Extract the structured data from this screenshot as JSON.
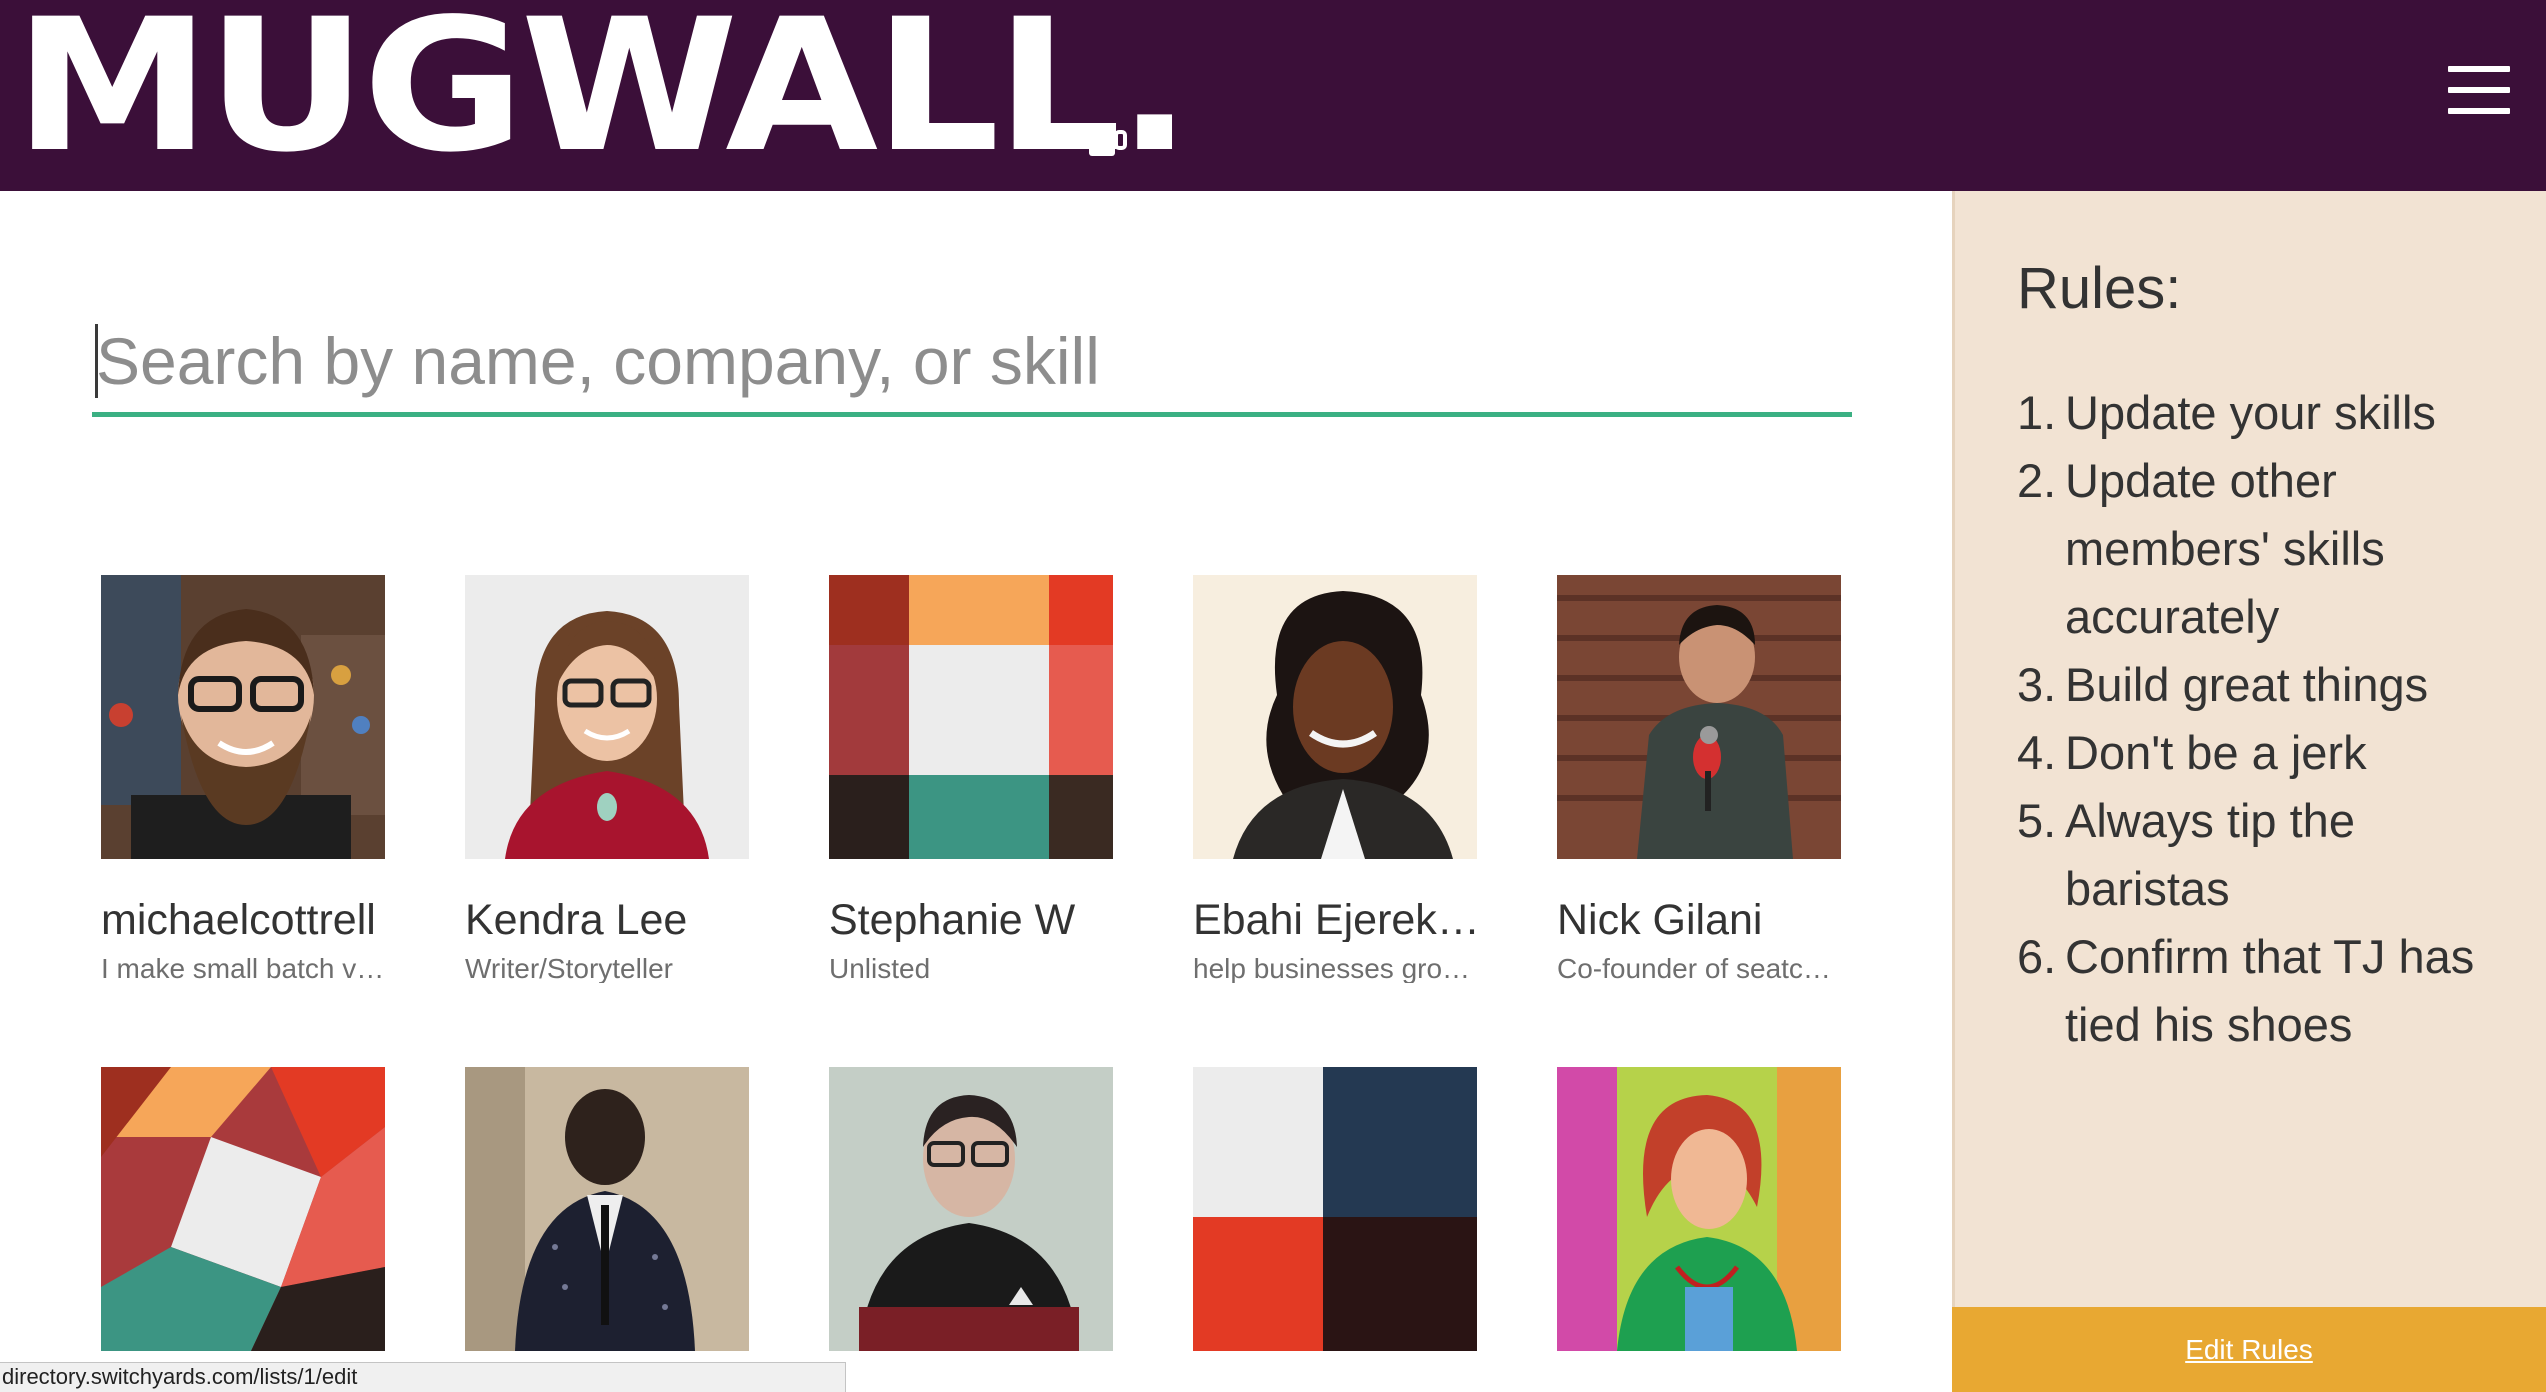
{
  "header": {
    "logo_text": "MUGWALL.",
    "menu_icon": "hamburger-menu-icon",
    "background": "#3b0f39"
  },
  "search": {
    "placeholder": "Search by name, company, or skill",
    "value": "",
    "accent": "#3bb083"
  },
  "members": [
    {
      "name": "michaelcottrell",
      "tagline": "I make small batch vid...",
      "avatar": "photo-bearded-man-glasses"
    },
    {
      "name": "Kendra Lee",
      "tagline": "Writer/Storyteller",
      "avatar": "photo-woman-glasses-red-top"
    },
    {
      "name": "Stephanie W",
      "tagline": "Unlisted",
      "avatar": "default-color-blocks"
    },
    {
      "name": "Ebahi Ejerekh...",
      "tagline": "help businesses grow ...",
      "avatar": "photo-woman-curly-hair"
    },
    {
      "name": "Nick Gilani",
      "tagline": "Co-founder of seatch...",
      "avatar": "photo-man-microphone-brick-wall"
    },
    {
      "name": "",
      "tagline": "",
      "avatar": "default-color-blocks-rotated"
    },
    {
      "name": "",
      "tagline": "",
      "avatar": "photo-man-suit"
    },
    {
      "name": "",
      "tagline": "",
      "avatar": "photo-starfleet-uniform"
    },
    {
      "name": "",
      "tagline": "",
      "avatar": "default-color-blocks-navy"
    },
    {
      "name": "",
      "tagline": "",
      "avatar": "photo-woman-colorful"
    }
  ],
  "sidebar": {
    "title": "Rules:",
    "rules": [
      {
        "num": "1.",
        "text": "Update your skills"
      },
      {
        "num": "2.",
        "text": "Update other members' skills accurately"
      },
      {
        "num": "3.",
        "text": "Build great things"
      },
      {
        "num": "4.",
        "text": "Don't be a jerk"
      },
      {
        "num": "5.",
        "text": "Always tip the baristas"
      },
      {
        "num": "6.",
        "text": "Confirm that TJ has tied his shoes"
      }
    ],
    "edit_label": "Edit Rules",
    "background": "#f2e3d3",
    "button_color": "#e8a832"
  },
  "status_bar": {
    "url": "directory.switchyards.com/lists/1/edit"
  }
}
